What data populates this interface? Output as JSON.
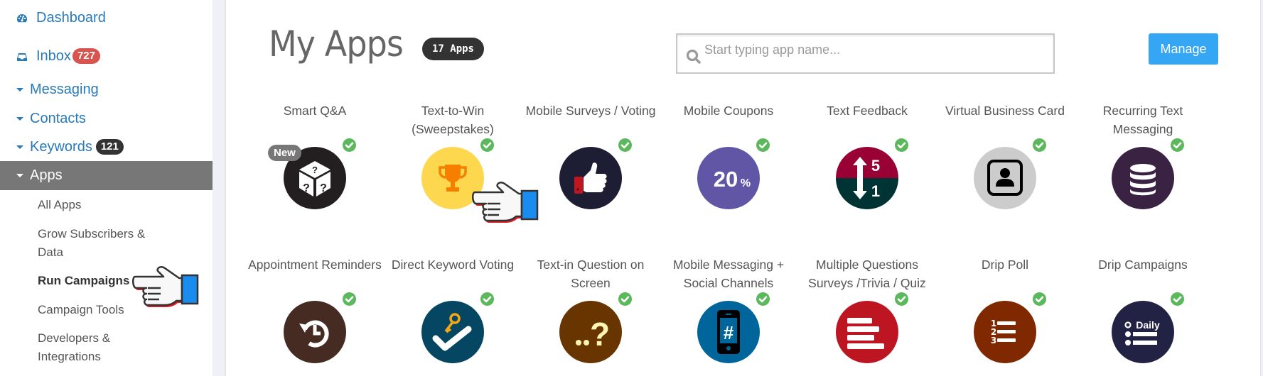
{
  "sidebar": {
    "items": [
      {
        "label": "Dashboard",
        "icon": "dashboard-icon"
      },
      {
        "label": "Inbox",
        "icon": "inbox-icon",
        "badge": "727",
        "badge_color": "#d9534f"
      },
      {
        "label": "Messaging",
        "icon": "caret-down-icon"
      },
      {
        "label": "Contacts",
        "icon": "caret-down-icon"
      },
      {
        "label": "Keywords",
        "icon": "caret-down-icon",
        "badge": "121",
        "badge_color": "#333333"
      },
      {
        "label": "Apps",
        "icon": "caret-down-icon",
        "active": true
      }
    ],
    "sub_items": [
      {
        "label": "All Apps"
      },
      {
        "label": "Grow Subscribers & Data"
      },
      {
        "label": "Run Campaigns",
        "bold": true
      },
      {
        "label": "Campaign Tools"
      },
      {
        "label": "Developers & Integrations"
      }
    ]
  },
  "header": {
    "title": "My Apps",
    "count_badge": "17 Apps",
    "search_placeholder": "Start typing app name...",
    "search_value": "",
    "manage_label": "Manage"
  },
  "colors": {
    "link": "#2a7ab8",
    "active_nav": "#777777",
    "manage_button": "#35a6f4",
    "check": "#5cb85c"
  },
  "apps": [
    {
      "name": "Smart Q&A",
      "icon": "dice-question-icon",
      "bg": "#231f20",
      "installed": true,
      "badge": "New"
    },
    {
      "name": "Text-to-Win (Sweepstakes)",
      "icon": "trophy-icon",
      "bg": "#fdd84f",
      "installed": true
    },
    {
      "name": "Mobile Surveys / Voting",
      "icon": "thumbs-up-icon",
      "bg": "#1d1d33",
      "installed": true
    },
    {
      "name": "Mobile Coupons",
      "icon": "percent-20-icon",
      "bg": "#6155a6",
      "installed": true,
      "icon_text": "20%"
    },
    {
      "name": "Text Feedback",
      "icon": "rating-arrows-icon",
      "bg": "#990033",
      "bg2": "#003333",
      "installed": true,
      "icon_text_top": "5",
      "icon_text_bottom": "1"
    },
    {
      "name": "Virtual Business Card",
      "icon": "contact-card-icon",
      "bg": "#cccccc",
      "installed": true
    },
    {
      "name": "Recurring Text Messaging",
      "icon": "database-stack-icon",
      "bg": "#3a2243",
      "installed": true
    },
    {
      "name": "Appointment Reminders",
      "icon": "history-clock-icon",
      "bg": "#452b22",
      "installed": true
    },
    {
      "name": "Direct Keyword Voting",
      "icon": "key-check-icon",
      "bg": "#054763",
      "installed": true
    },
    {
      "name": "Text-in Question on Screen",
      "icon": "question-dots-icon",
      "bg": "#683400",
      "installed": true
    },
    {
      "name": "Mobile Messaging + Social Channels",
      "icon": "phone-hashtag-icon",
      "bg": "#00659a",
      "installed": true
    },
    {
      "name": "Multiple Questions Surveys /Trivia / Quiz",
      "icon": "bars-list-icon",
      "bg": "#bd1622",
      "installed": true
    },
    {
      "name": "Drip Poll",
      "icon": "numbered-list-icon",
      "bg": "#802900",
      "installed": true
    },
    {
      "name": "Drip Campaigns",
      "icon": "daily-list-icon",
      "bg": "#212244",
      "installed": true,
      "icon_text": "Daily"
    }
  ]
}
